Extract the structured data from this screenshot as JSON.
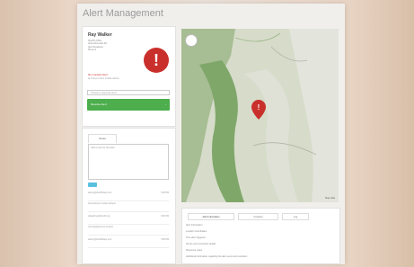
{
  "page": {
    "title": "Alert Management"
  },
  "alert": {
    "name": "Ray Walker",
    "address_lines": [
      "Sheriff's Office",
      "Alpine Mountain Rd.",
      "Alert Residence",
      "Phone #"
    ],
    "status": "No Contact Alert",
    "status_detail": "at 3:42 pm from mobile device",
    "icon": "exclamation-icon",
    "select_placeholder": "Choose a response level",
    "action_button": "Resolve Alert"
  },
  "notes": {
    "tab_label": "Notes",
    "textarea_placeholder": "Add a note for this alert",
    "entries": [
      {
        "author": "admin@sheriffsdept.com",
        "time": "3:48 PM",
        "text": "Attempting to contact subject"
      },
      {
        "author": "dispatcher@sheriff.org",
        "time": "3:52 PM",
        "text": "Unit dispatched to location"
      },
      {
        "author": "admin@sheriffsdept.com",
        "time": "3:55 PM",
        "text": ""
      }
    ]
  },
  "map": {
    "attribution": "Map data"
  },
  "info": {
    "tabs": [
      "Alert Information",
      "Contacts",
      "Log"
    ],
    "lines": [
      "Alert Information",
      "Location coordinates",
      "Time alert triggered",
      "Device and connection details",
      "Response notes",
      "Additional information regarding the alert event and resolution"
    ]
  },
  "colors": {
    "danger": "#c9302c",
    "success": "#4cae4c",
    "info": "#5bc0de"
  }
}
